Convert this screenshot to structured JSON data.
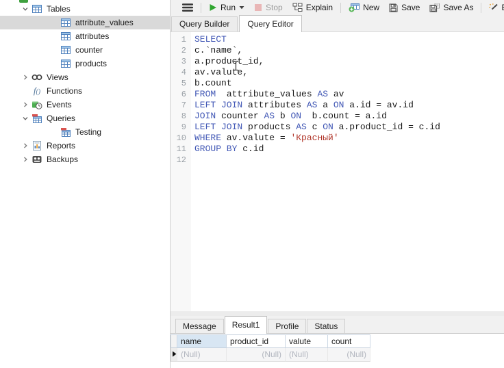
{
  "sidebar": {
    "items": [
      {
        "label": "Tables",
        "level": 0,
        "state": "expanded",
        "icon": "table-icon",
        "selected": false
      },
      {
        "label": "attribute_values",
        "level": 1,
        "state": "none",
        "icon": "table-icon",
        "selected": true
      },
      {
        "label": "attributes",
        "level": 1,
        "state": "none",
        "icon": "table-icon",
        "selected": false
      },
      {
        "label": "counter",
        "level": 1,
        "state": "none",
        "icon": "table-icon",
        "selected": false
      },
      {
        "label": "products",
        "level": 1,
        "state": "none",
        "icon": "table-icon",
        "selected": false
      },
      {
        "label": "Views",
        "level": 0,
        "state": "collapsed",
        "icon": "views-icon",
        "selected": false
      },
      {
        "label": "Functions",
        "level": 0,
        "state": "none",
        "icon": "functions-icon",
        "selected": false
      },
      {
        "label": "Events",
        "level": 0,
        "state": "collapsed",
        "icon": "events-icon",
        "selected": false
      },
      {
        "label": "Queries",
        "level": 0,
        "state": "expanded",
        "icon": "query-icon",
        "selected": false
      },
      {
        "label": "Testing",
        "level": 1,
        "state": "none",
        "icon": "query-icon",
        "selected": false
      },
      {
        "label": "Reports",
        "level": 0,
        "state": "collapsed",
        "icon": "reports-icon",
        "selected": false
      },
      {
        "label": "Backups",
        "level": 0,
        "state": "collapsed",
        "icon": "backups-icon",
        "selected": false
      }
    ]
  },
  "toolbar": {
    "menu_icon": "hamburger-icon",
    "groups": [
      [
        {
          "label": "Run",
          "icon": "run-icon",
          "caret": true,
          "disabled": false
        },
        {
          "label": "Stop",
          "icon": "stop-icon",
          "caret": false,
          "disabled": true
        },
        {
          "label": "Explain",
          "icon": "explain-icon",
          "caret": false,
          "disabled": false
        }
      ],
      [
        {
          "label": "New",
          "icon": "new-icon",
          "caret": false,
          "disabled": false
        },
        {
          "label": "Save",
          "icon": "save-icon",
          "caret": false,
          "disabled": false
        },
        {
          "label": "Save As",
          "icon": "save-as-icon",
          "caret": false,
          "disabled": false
        }
      ],
      [
        {
          "label": "Bea",
          "icon": "beautify-icon",
          "caret": false,
          "disabled": false,
          "truncated": true
        }
      ]
    ]
  },
  "doc_tabs": [
    {
      "label": "Query Builder",
      "active": false
    },
    {
      "label": "Query Editor",
      "active": true
    }
  ],
  "editor": {
    "lines": [
      {
        "num": "1",
        "tokens": [
          {
            "t": "kw",
            "v": "SELECT"
          }
        ]
      },
      {
        "num": "2",
        "tokens": [
          {
            "t": "id",
            "v": "c.`name`,"
          }
        ]
      },
      {
        "num": "3",
        "tokens": [
          {
            "t": "id",
            "v": "a.product_id,"
          }
        ]
      },
      {
        "num": "4",
        "tokens": [
          {
            "t": "id",
            "v": "av.valute,"
          }
        ]
      },
      {
        "num": "5",
        "tokens": [
          {
            "t": "id",
            "v": "b.count"
          }
        ]
      },
      {
        "num": "6",
        "tokens": [
          {
            "t": "kw",
            "v": "FROM"
          },
          {
            "t": "id",
            "v": "  attribute_values "
          },
          {
            "t": "kw",
            "v": "AS"
          },
          {
            "t": "id",
            "v": " av"
          }
        ]
      },
      {
        "num": "7",
        "tokens": [
          {
            "t": "kw",
            "v": "LEFT JOIN"
          },
          {
            "t": "id",
            "v": " attributes "
          },
          {
            "t": "kw",
            "v": "AS"
          },
          {
            "t": "id",
            "v": " a "
          },
          {
            "t": "kw",
            "v": "ON"
          },
          {
            "t": "id",
            "v": " a.id = av.id"
          }
        ]
      },
      {
        "num": "8",
        "tokens": [
          {
            "t": "kw",
            "v": "JOIN"
          },
          {
            "t": "id",
            "v": " counter "
          },
          {
            "t": "kw",
            "v": "AS"
          },
          {
            "t": "id",
            "v": " b "
          },
          {
            "t": "kw",
            "v": "ON"
          },
          {
            "t": "id",
            "v": "  b.count = a.id"
          }
        ]
      },
      {
        "num": "9",
        "tokens": [
          {
            "t": "kw",
            "v": "LEFT JOIN"
          },
          {
            "t": "id",
            "v": " products "
          },
          {
            "t": "kw",
            "v": "AS"
          },
          {
            "t": "id",
            "v": " c "
          },
          {
            "t": "kw",
            "v": "ON"
          },
          {
            "t": "id",
            "v": " a.product_id = c.id"
          }
        ]
      },
      {
        "num": "10",
        "tokens": [
          {
            "t": "kw",
            "v": "WHERE"
          },
          {
            "t": "id",
            "v": " av.valute = "
          },
          {
            "t": "str",
            "v": "'Красный'"
          }
        ]
      },
      {
        "num": "11",
        "tokens": [
          {
            "t": "kw",
            "v": "GROUP BY"
          },
          {
            "t": "id",
            "v": " c.id"
          }
        ]
      },
      {
        "num": "12",
        "tokens": []
      }
    ]
  },
  "result_tabs": [
    {
      "label": "Message",
      "active": false
    },
    {
      "label": "Result1",
      "active": true
    },
    {
      "label": "Profile",
      "active": false
    },
    {
      "label": "Status",
      "active": false
    }
  ],
  "grid": {
    "columns": [
      {
        "name": "name",
        "width": 72,
        "align": "left",
        "selected": true
      },
      {
        "name": "product_id",
        "width": 86,
        "align": "right",
        "selected": false
      },
      {
        "name": "valute",
        "width": 62,
        "align": "left",
        "selected": false
      },
      {
        "name": "count",
        "width": 62,
        "align": "right",
        "selected": false
      }
    ],
    "rows": [
      [
        "(Null)",
        "(Null)",
        "(Null)",
        "(Null)"
      ]
    ]
  },
  "colors": {
    "keyword_blue": "#4157b5",
    "string_red": "#b03428",
    "line_number_gray": "#9aa0a6",
    "selected_row_gray": "#d9d9d9",
    "selected_column_header_blue": "#d8e6f3",
    "null_text_gray": "#b2b6bf",
    "run_green": "#2fa52f"
  }
}
